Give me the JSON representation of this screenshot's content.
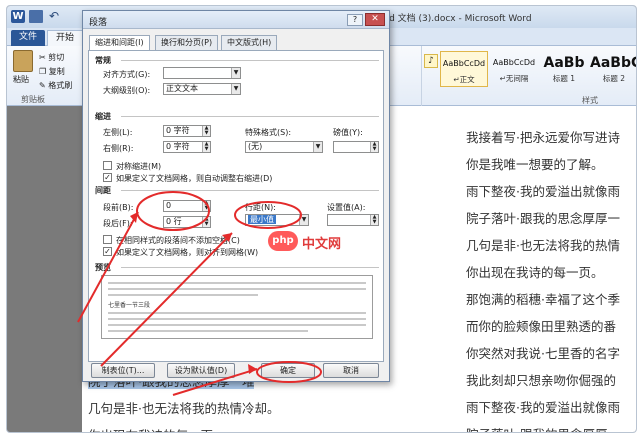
{
  "window": {
    "title": "新建 Microsoft Word 文档 (3).docx - Microsoft Word",
    "app_logo": "W"
  },
  "ribbon": {
    "tabs": [
      "文件",
      "开始"
    ],
    "clipboard": {
      "paste": "粘贴",
      "cut": "剪切",
      "copy": "复制",
      "format_painter": "格式刷",
      "group_label": "剪贴板"
    },
    "styles": {
      "group_label": "样式",
      "items": [
        {
          "preview": "AaBbCcDd",
          "name": "↵正文"
        },
        {
          "preview": "AaBbCcDd",
          "name": "↵无间隔"
        },
        {
          "preview": "AaBb",
          "name": "标题 1"
        },
        {
          "preview": "AaBbC",
          "name": "标题 2"
        }
      ]
    }
  },
  "document": {
    "right_lines": [
      "我接着写·把永远爱你写进诗",
      "你是我唯一想要的了解。",
      "雨下整夜·我的爱溢出就像雨",
      "院子落叶·跟我的思念厚厚一",
      "几句是非·也无法将我的热情",
      "你出现在我诗的每一页。",
      "那饱满的稻穗·幸福了这个季",
      "而你的脸颊像田里熟透的番",
      "你突然对我说·七里香的名字",
      "我此刻却只想亲吻你倔强的",
      "雨下整夜·我的爱溢出就像雨",
      "院子落叶·跟我的思念厚厚一"
    ],
    "left_lines": [
      "院子落叶·跟我的思念厚厚一堆",
      "几句是非·也无法将我的热情冷却。",
      "你出现在我诗的每一页"
    ]
  },
  "dialog": {
    "title": "段落",
    "help": "?",
    "close": "✕",
    "tabs": [
      "缩进和间距(I)",
      "换行和分页(P)",
      "中文版式(H)"
    ],
    "general": {
      "heading": "常规",
      "alignment_label": "对齐方式(G):",
      "alignment_value": "",
      "outline_label": "大纲级别(O):",
      "outline_value": "正文文本"
    },
    "indent": {
      "heading": "缩进",
      "left_label": "左侧(L):",
      "left_value": "0 字符",
      "right_label": "右侧(R):",
      "right_value": "0 字符",
      "special_label": "特殊格式(S):",
      "special_value": "(无)",
      "by_label": "磅值(Y):",
      "by_value": "",
      "mirror_label": "对称缩进(M)",
      "mirror_checked": false,
      "auto_right_label": "如果定义了文档网格，则自动调整右缩进(D)",
      "auto_right_checked": true
    },
    "spacing": {
      "heading": "间距",
      "before_label": "段前(B):",
      "before_value": "0",
      "after_label": "段后(F):",
      "after_value": "0 行",
      "line_label": "行距(N):",
      "line_value": "最小值",
      "at_label": "设置值(A):",
      "at_value": "",
      "no_space_label": "在相同样式的段落间不添加空格(C)",
      "no_space_checked": false,
      "snap_label": "如果定义了文档网格，则对齐到网格(W)",
      "snap_checked": true
    },
    "preview": {
      "heading": "预览",
      "filler": "前一段落前一段落前一段落前一段落前一段落前一段落前一段落前一段落",
      "sample": "七里香一节三段"
    },
    "buttons": {
      "tabs": "制表位(T)...",
      "default": "设为默认值(D)",
      "ok": "确定",
      "cancel": "取消"
    }
  },
  "watermark": {
    "badge": "php",
    "text": "中文网"
  },
  "colors": {
    "annotation": "#e32b2b",
    "file_tab": "#2b5797",
    "highlight": "#a9c7ea"
  }
}
